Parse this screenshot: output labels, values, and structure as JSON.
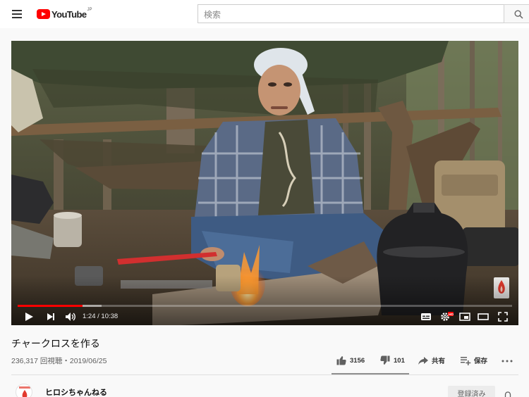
{
  "masthead": {
    "logo_text": "YouTube",
    "logo_country": "JP",
    "search_placeholder": "検索",
    "icons": [
      "menu-icon",
      "youtube-logo-icon",
      "search-icon"
    ]
  },
  "player": {
    "time": "1:24 / 10:38",
    "progress_played_fraction": 0.1317,
    "progress_loaded_fraction": 0.17,
    "icons": [
      "play-icon",
      "next-icon",
      "volume-icon",
      "subtitles-icon",
      "settings-icon",
      "hd-badge-icon",
      "miniplayer-icon",
      "theater-icon",
      "fullscreen-icon"
    ],
    "colors": {
      "progress": "#ff0000",
      "hd_badge": "#ff0000"
    }
  },
  "video": {
    "title": "チャークロスを作る",
    "views_date": "236,317 回視聴・2019/06/25"
  },
  "actions": {
    "like_count": "3156",
    "dislike_count": "101",
    "share_label": "共有",
    "save_label": "保存",
    "icons": [
      "thumbs-up-icon",
      "thumbs-down-icon",
      "share-icon",
      "playlist-add-icon",
      "more-icon"
    ]
  },
  "owner": {
    "channel_name": "ヒロシちゃんねる",
    "subscribe_label": "登録済み",
    "icons": [
      "channel-avatar",
      "bell-icon"
    ]
  },
  "colors": {
    "brand": "#ff0000",
    "page_bg": "#f9f9f9"
  }
}
